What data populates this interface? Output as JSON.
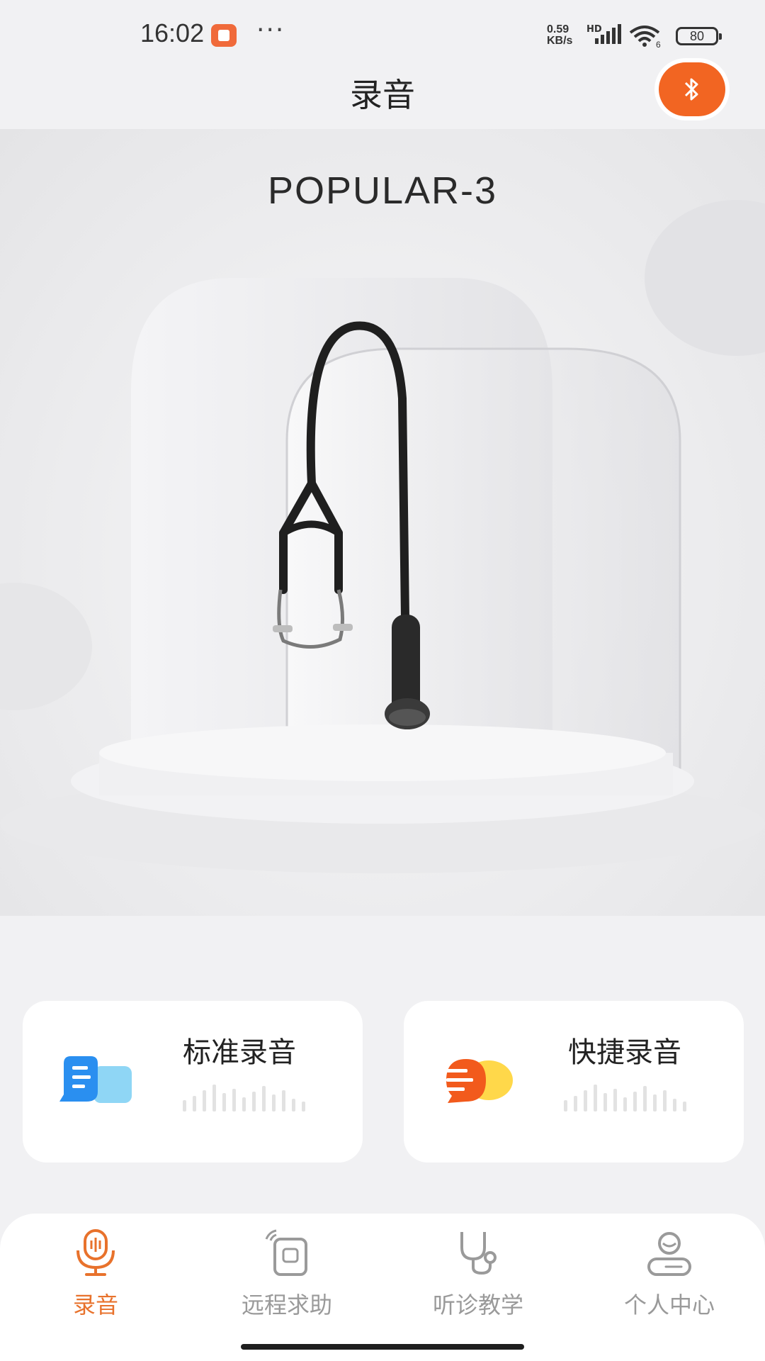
{
  "status_bar": {
    "time": "16:02",
    "network_speed_value": "0.59",
    "network_speed_unit": "KB/s",
    "network_type": "HD",
    "wifi_label": "6",
    "battery": "80",
    "more_indicator": "···"
  },
  "header": {
    "title": "录音",
    "bluetooth_icon": "bluetooth-icon"
  },
  "hero": {
    "device_name": "POPULAR-3",
    "image": "stethoscope-product-image"
  },
  "cards": [
    {
      "title": "标准录音",
      "icon": "chat-bubble-icon",
      "icon_color": "#2a8ff0"
    },
    {
      "title": "快捷录音",
      "icon": "quick-chat-icon",
      "icon_color": "#f25a1c"
    }
  ],
  "bottom_nav": {
    "items": [
      {
        "label": "录音",
        "icon": "microphone-icon",
        "active": true
      },
      {
        "label": "远程求助",
        "icon": "remote-device-icon",
        "active": false
      },
      {
        "label": "听诊教学",
        "icon": "stethoscope-icon",
        "active": false
      },
      {
        "label": "个人中心",
        "icon": "user-icon",
        "active": false
      }
    ],
    "active_color": "#e8722c",
    "inactive_color": "#9a9a9a"
  },
  "colors": {
    "accent": "#f26522",
    "background": "#f1f1f3"
  }
}
